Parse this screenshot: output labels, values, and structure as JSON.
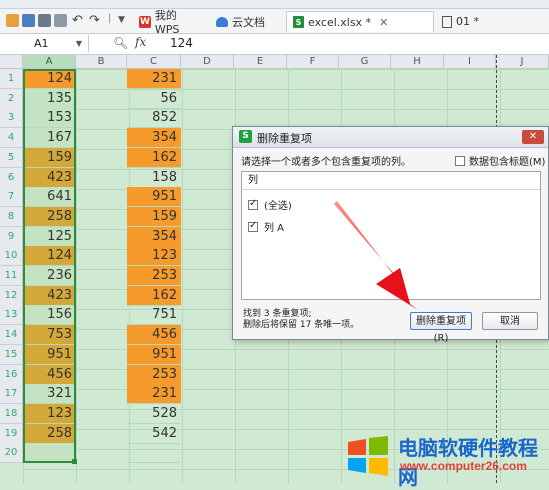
{
  "colors": {
    "orange": "#f79a2c",
    "gold": "#d4a838",
    "light_green": "#c3e3c3",
    "sheet_bg": "#cfe9d2",
    "selection": "#2e8b3e"
  },
  "menubar": {
    "items": [
      "",
      "",
      "",
      "",
      ""
    ]
  },
  "tabs": [
    {
      "label": "我的WPS",
      "icon": "wps-icon"
    },
    {
      "label": "云文档",
      "icon": "cloud-icon"
    },
    {
      "label": "excel.xlsx *",
      "icon": "xlsx-icon"
    },
    {
      "label": "01 *",
      "icon": "doc-icon"
    }
  ],
  "formula_bar": {
    "cell_ref": "A1",
    "fx_label": "fx",
    "value": "124"
  },
  "columns": [
    "A",
    "B",
    "C",
    "D",
    "E",
    "F",
    "G",
    "H",
    "I",
    "J"
  ],
  "rows": [
    "1",
    "2",
    "3",
    "4",
    "5",
    "6",
    "7",
    "8",
    "9",
    "10",
    "11",
    "12",
    "13",
    "14",
    "15",
    "16",
    "17",
    "18",
    "19",
    "20"
  ],
  "column_a": [
    {
      "v": "124",
      "c": "orange"
    },
    {
      "v": "135",
      "c": "light"
    },
    {
      "v": "153",
      "c": "light"
    },
    {
      "v": "167",
      "c": "light"
    },
    {
      "v": "159",
      "c": "gold"
    },
    {
      "v": "423",
      "c": "gold"
    },
    {
      "v": "641",
      "c": "light"
    },
    {
      "v": "258",
      "c": "gold"
    },
    {
      "v": "125",
      "c": "light"
    },
    {
      "v": "124",
      "c": "gold"
    },
    {
      "v": "236",
      "c": "light"
    },
    {
      "v": "423",
      "c": "gold"
    },
    {
      "v": "156",
      "c": "light"
    },
    {
      "v": "753",
      "c": "gold"
    },
    {
      "v": "951",
      "c": "gold"
    },
    {
      "v": "456",
      "c": "gold"
    },
    {
      "v": "321",
      "c": "light"
    },
    {
      "v": "123",
      "c": "gold"
    },
    {
      "v": "258",
      "c": "gold"
    },
    {
      "v": "",
      "c": "light"
    }
  ],
  "column_c": [
    {
      "v": "231",
      "c": "orange"
    },
    {
      "v": "56",
      "c": "none"
    },
    {
      "v": "852",
      "c": "none"
    },
    {
      "v": "354",
      "c": "orange"
    },
    {
      "v": "162",
      "c": "orange"
    },
    {
      "v": "158",
      "c": "none"
    },
    {
      "v": "951",
      "c": "orange"
    },
    {
      "v": "159",
      "c": "orange"
    },
    {
      "v": "354",
      "c": "orange"
    },
    {
      "v": "123",
      "c": "orange"
    },
    {
      "v": "253",
      "c": "orange"
    },
    {
      "v": "162",
      "c": "orange"
    },
    {
      "v": "751",
      "c": "none"
    },
    {
      "v": "456",
      "c": "orange"
    },
    {
      "v": "951",
      "c": "orange"
    },
    {
      "v": "253",
      "c": "orange"
    },
    {
      "v": "231",
      "c": "orange"
    },
    {
      "v": "528",
      "c": "none"
    },
    {
      "v": "542",
      "c": "none"
    },
    {
      "v": "",
      "c": "none"
    }
  ],
  "dialog": {
    "title": "删除重复项",
    "prompt": "请选择一个或者多个包含重复项的列。",
    "header_checkbox_label": "数据包含标题(M)",
    "header_checkbox_checked": false,
    "list_header": "列",
    "items": [
      {
        "label": "(全选)",
        "checked": true
      },
      {
        "label": "列 A",
        "checked": true
      }
    ],
    "found_line1": "找到 3 条重复项;",
    "found_line2": "删除后将保留 17 条唯一项。",
    "primary_button": "删除重复项(R)",
    "cancel_button": "取消"
  },
  "watermark": {
    "title": "电脑软硬件教程网",
    "url": "www.computer26.com"
  }
}
